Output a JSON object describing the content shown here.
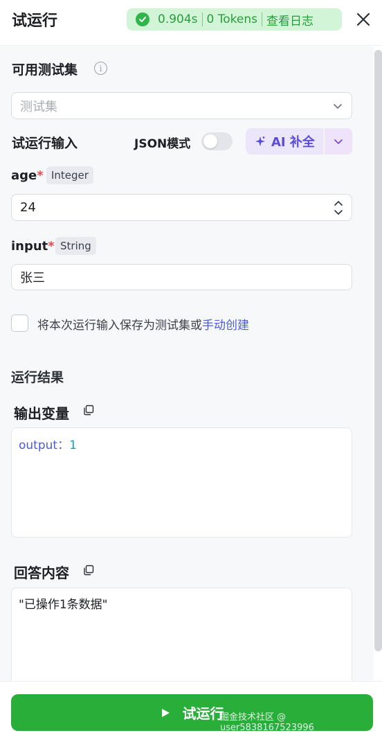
{
  "header": {
    "title": "试运行",
    "status_time": "0.904s",
    "status_tokens": "0 Tokens",
    "view_log": "查看日志"
  },
  "testset": {
    "label": "可用测试集",
    "info_glyph": "i",
    "placeholder": "测试集"
  },
  "input_section": {
    "label": "试运行输入",
    "json_mode_label": "JSON模式",
    "json_mode_on": false,
    "ai_complete_label": "AI 补全"
  },
  "fields": [
    {
      "name": "age",
      "required_mark": "*",
      "type": "Integer",
      "value": "24"
    },
    {
      "name": "input",
      "required_mark": "*",
      "type": "String",
      "value": "张三"
    }
  ],
  "save": {
    "text": "将本次运行输入保存为测试集或",
    "link": "手动创建",
    "checked": false
  },
  "result": {
    "title": "运行结果",
    "output_label": "输出变量",
    "output_key": "output",
    "output_sep": "：",
    "output_value": "1",
    "answer_label": "回答内容",
    "answer_value": "\"已操作1条数据\""
  },
  "footer": {
    "run_label": "试运行",
    "watermark": "掘金技术社区 @ user5838167523996"
  },
  "colors": {
    "accent_green": "#29ae39",
    "status_bg": "#d3f5d7",
    "ai_purple": "#5a4bd9",
    "link_blue": "#4d5bd8",
    "required_red": "#e5484d"
  },
  "icons": [
    "check-circle-icon",
    "close-icon",
    "info-icon",
    "chevron-down-icon",
    "sparkle-icon",
    "stepper-icon",
    "copy-icon",
    "play-icon"
  ]
}
